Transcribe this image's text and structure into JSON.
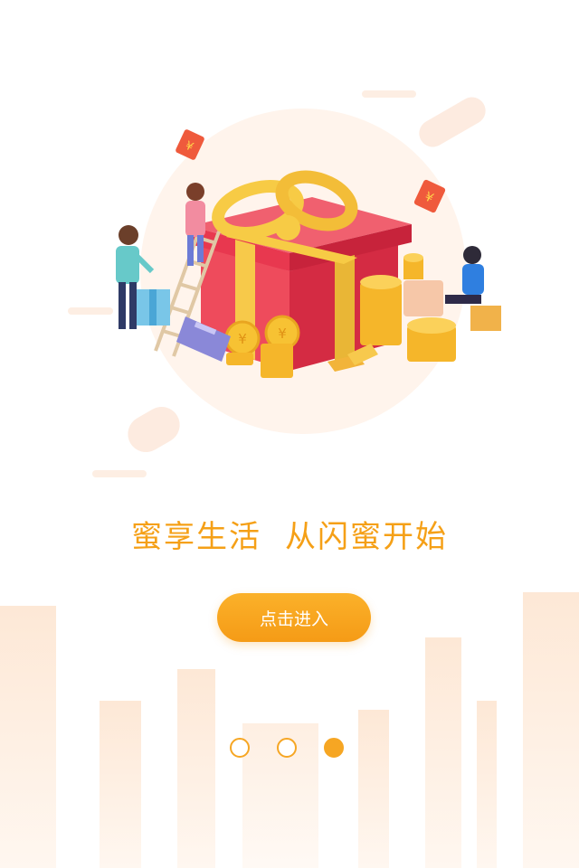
{
  "tagline": {
    "part1": "蜜享生活",
    "part2": "从闪蜜开始"
  },
  "enter_button": {
    "label": "点击进入"
  },
  "pager": {
    "total": 3,
    "active_index": 2
  },
  "illustration": {
    "envelope_symbol": "¥",
    "coin_symbol": "¥"
  },
  "colors": {
    "accent": "#f5a017",
    "button": "#f6a623",
    "gift_red": "#e8384f",
    "ribbon": "#f7cb45",
    "coin": "#f7c233",
    "skyline": "#fdeee0"
  }
}
